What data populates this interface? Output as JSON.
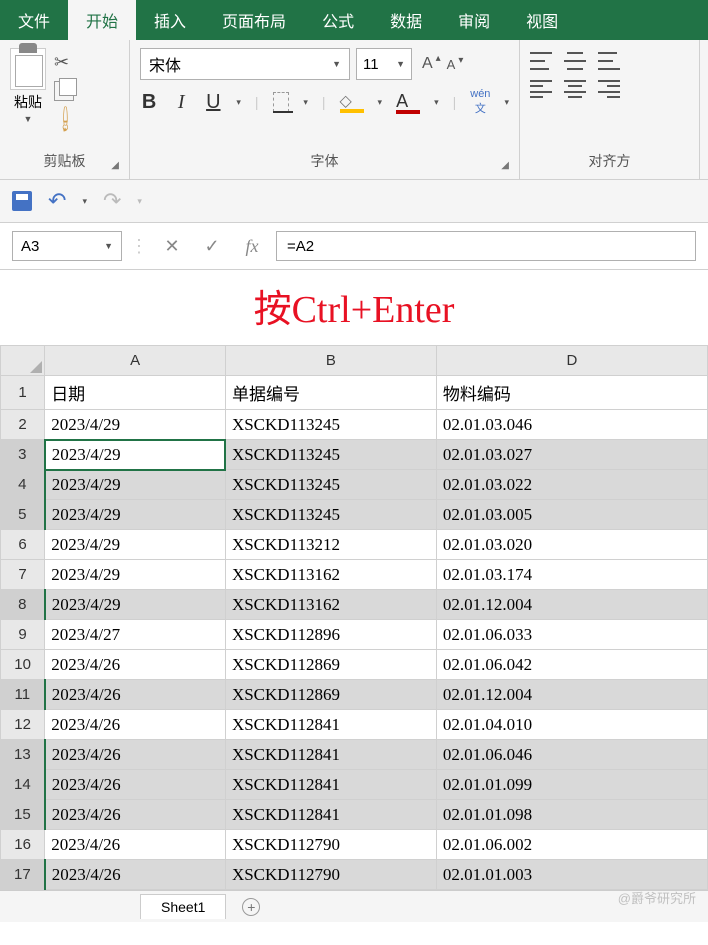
{
  "menu": {
    "file": "文件",
    "home": "开始",
    "insert": "插入",
    "layout": "页面布局",
    "formula": "公式",
    "data": "数据",
    "review": "审阅",
    "view": "视图"
  },
  "ribbon": {
    "clipboard": {
      "label": "剪贴板",
      "paste": "粘贴"
    },
    "font": {
      "label": "字体",
      "name": "宋体",
      "size": "11",
      "wen_top": "wén",
      "wen_bottom": "文"
    },
    "align": {
      "label": "对齐方"
    }
  },
  "formula_bar": {
    "name_box": "A3",
    "formula": "=A2"
  },
  "annotation": "按Ctrl+Enter",
  "headers": {
    "A": "A",
    "B": "B",
    "D": "D"
  },
  "columns": {
    "date": "日期",
    "doc": "单据编号",
    "material": "物料编码"
  },
  "rows": [
    {
      "n": 1,
      "a": "日期",
      "b": "单据编号",
      "d": "物料编码",
      "sel": false
    },
    {
      "n": 2,
      "a": "2023/4/29",
      "b": "XSCKD113245",
      "d": "02.01.03.046",
      "sel": false
    },
    {
      "n": 3,
      "a": "2023/4/29",
      "b": "XSCKD113245",
      "d": "02.01.03.027",
      "sel": true,
      "active": true
    },
    {
      "n": 4,
      "a": "2023/4/29",
      "b": "XSCKD113245",
      "d": "02.01.03.022",
      "sel": true
    },
    {
      "n": 5,
      "a": "2023/4/29",
      "b": "XSCKD113245",
      "d": "02.01.03.005",
      "sel": true
    },
    {
      "n": 6,
      "a": "2023/4/29",
      "b": "XSCKD113212",
      "d": "02.01.03.020",
      "sel": false
    },
    {
      "n": 7,
      "a": "2023/4/29",
      "b": "XSCKD113162",
      "d": "02.01.03.174",
      "sel": false
    },
    {
      "n": 8,
      "a": "2023/4/29",
      "b": "XSCKD113162",
      "d": "02.01.12.004",
      "sel": true
    },
    {
      "n": 9,
      "a": "2023/4/27",
      "b": "XSCKD112896",
      "d": "02.01.06.033",
      "sel": false
    },
    {
      "n": 10,
      "a": "2023/4/26",
      "b": "XSCKD112869",
      "d": "02.01.06.042",
      "sel": false
    },
    {
      "n": 11,
      "a": "2023/4/26",
      "b": "XSCKD112869",
      "d": "02.01.12.004",
      "sel": true
    },
    {
      "n": 12,
      "a": "2023/4/26",
      "b": "XSCKD112841",
      "d": "02.01.04.010",
      "sel": false
    },
    {
      "n": 13,
      "a": "2023/4/26",
      "b": "XSCKD112841",
      "d": "02.01.06.046",
      "sel": true
    },
    {
      "n": 14,
      "a": "2023/4/26",
      "b": "XSCKD112841",
      "d": "02.01.01.099",
      "sel": true
    },
    {
      "n": 15,
      "a": "2023/4/26",
      "b": "XSCKD112841",
      "d": "02.01.01.098",
      "sel": true
    },
    {
      "n": 16,
      "a": "2023/4/26",
      "b": "XSCKD112790",
      "d": "02.01.06.002",
      "sel": false
    },
    {
      "n": 17,
      "a": "2023/4/26",
      "b": "XSCKD112790",
      "d": "02.01.01.003",
      "sel": true
    }
  ],
  "sheet_tab": "Sheet1",
  "watermark": "@爵爷研究所"
}
